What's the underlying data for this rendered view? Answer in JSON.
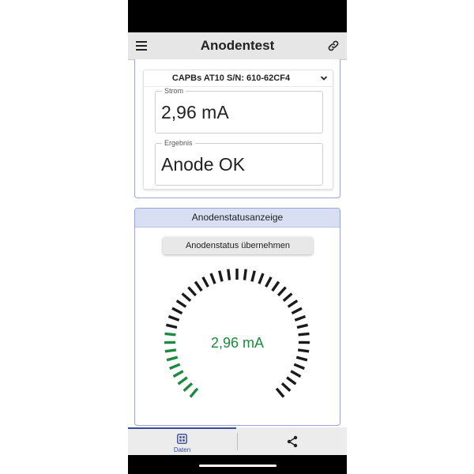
{
  "app": {
    "title": "Anodentest"
  },
  "device": {
    "selected": "CAPBs AT10 S/N: 610-62CF4"
  },
  "fields": {
    "strom": {
      "label": "Strom",
      "value": "2,96 mA"
    },
    "ergebnis": {
      "label": "Ergebnis",
      "value": "Anode OK"
    }
  },
  "status_panel": {
    "title": "Anodenstatusanzeige",
    "accept_button": "Anodenstatus übernehmen",
    "gauge": {
      "value_text": "2,96 mA",
      "segments_total": 41,
      "segments_active": 9
    }
  },
  "bottom_nav": {
    "daten_label": "Daten"
  },
  "icons": [
    "menu-icon",
    "link-icon",
    "chevron-down-icon",
    "grid-icon",
    "share-icon"
  ],
  "colors": {
    "accent": "#3a4a9a",
    "gauge_active": "#1e8a3e",
    "gauge_inactive": "#1a1a1a",
    "panel_header": "#d8dff2"
  }
}
